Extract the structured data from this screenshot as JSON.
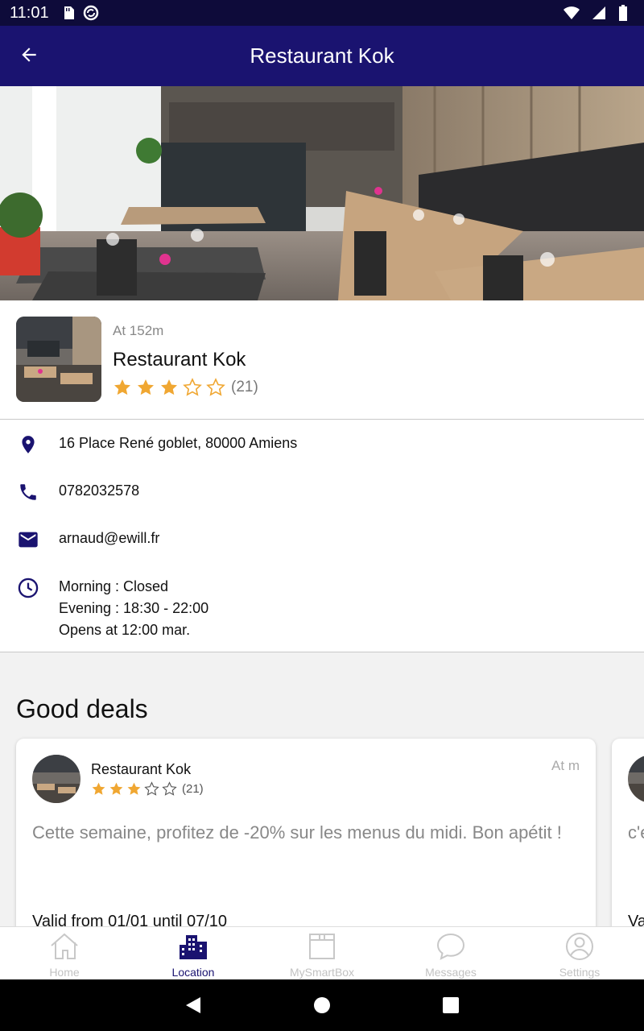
{
  "status_bar": {
    "time": "11:01",
    "icons": [
      "sd-card-icon",
      "sync-icon",
      "wifi-icon",
      "signal-icon",
      "battery-icon"
    ]
  },
  "app_bar": {
    "title": "Restaurant Kok",
    "back_icon": "arrow-back-icon"
  },
  "restaurant": {
    "distance": "At 152m",
    "name": "Restaurant Kok",
    "rating": 3,
    "rating_max": 5,
    "reviews": "(21)"
  },
  "contact": {
    "address": "16 Place René goblet, 80000 Amiens",
    "phone": "0782032578",
    "email": "arnaud@ewill.fr",
    "hours": [
      "Morning : Closed",
      "Evening : 18:30 - 22:00",
      "Opens at 12:00 mar."
    ]
  },
  "deals": {
    "title": "Good deals",
    "cards": [
      {
        "name": "Restaurant Kok",
        "rating": 3,
        "reviews": "(21)",
        "distance": "At m",
        "text": "Cette semaine, profitez de -20% sur les menus du midi. Bon apétit !",
        "valid": "Valid from 01/01 until 07/10"
      },
      {
        "text_partial": "c'e",
        "valid_partial": "Va"
      }
    ]
  },
  "bottom_nav": {
    "items": [
      {
        "label": "Home",
        "icon": "home-icon",
        "active": false
      },
      {
        "label": "Location",
        "icon": "city-icon",
        "active": true
      },
      {
        "label": "MySmartBox",
        "icon": "box-icon",
        "active": false
      },
      {
        "label": "Messages",
        "icon": "chat-icon",
        "active": false
      },
      {
        "label": "Settings",
        "icon": "account-icon",
        "active": false
      }
    ]
  },
  "colors": {
    "primary": "#1a1370",
    "status_bar": "#0e0b3a",
    "star": "#f0a732",
    "inactive": "#c2c2c2"
  }
}
